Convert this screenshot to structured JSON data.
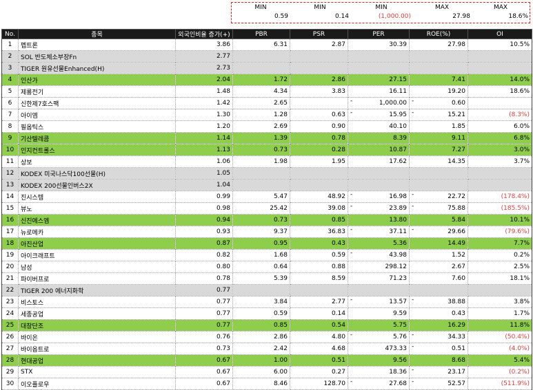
{
  "minmax": [
    {
      "label": "MIN",
      "value": "0.59",
      "negative": false
    },
    {
      "label": "MIN",
      "value": "0.14",
      "negative": false
    },
    {
      "label": "MIN",
      "value": "(1,000.00)",
      "negative": true
    },
    {
      "label": "MAX",
      "value": "27.98",
      "negative": false
    },
    {
      "label": "MAX",
      "value": "18.6%",
      "negative": false
    }
  ],
  "headers": [
    "No.",
    "종목",
    "외국인비율 증가(+)",
    "PBR",
    "PSR",
    "PER",
    "ROE(%)",
    "OI"
  ],
  "rows": [
    {
      "no": "1",
      "name": "펩트론",
      "f": "3.86",
      "pbr": "6.31",
      "psr": "2.87",
      "per": "30.39",
      "roe": "27.98",
      "oi": "10.5%",
      "style": "",
      "oi_neg": false,
      "per_dash": false,
      "roe_dash": false,
      "psr_dash": false
    },
    {
      "no": "2",
      "name": "SOL 반도체소부장Fn",
      "f": "2.77",
      "pbr": "",
      "psr": "",
      "per": "",
      "roe": "",
      "oi": "",
      "style": "grey",
      "oi_neg": false,
      "per_dash": false,
      "roe_dash": false,
      "psr_dash": false
    },
    {
      "no": "3",
      "name": "TIGER 원유선물Enhanced(H)",
      "f": "2.73",
      "pbr": "",
      "psr": "",
      "per": "",
      "roe": "",
      "oi": "",
      "style": "grey",
      "oi_neg": false,
      "per_dash": false,
      "roe_dash": false,
      "psr_dash": false
    },
    {
      "no": "4",
      "name": "인산가",
      "f": "2.04",
      "pbr": "1.72",
      "psr": "2.86",
      "per": "27.15",
      "roe": "7.41",
      "oi": "14.0%",
      "style": "green",
      "oi_neg": false,
      "per_dash": false,
      "roe_dash": false,
      "psr_dash": false
    },
    {
      "no": "5",
      "name": "제룡전기",
      "f": "1.48",
      "pbr": "4.34",
      "psr": "3.83",
      "per": "16.11",
      "roe": "19.20",
      "oi": "18.6%",
      "style": "",
      "oi_neg": false,
      "per_dash": false,
      "roe_dash": false,
      "psr_dash": false
    },
    {
      "no": "6",
      "name": "신한제7호스팩",
      "f": "1.42",
      "pbr": "2.65",
      "psr": "",
      "per": "1,000.00",
      "roe": "0.60",
      "oi": "",
      "style": "",
      "oi_neg": false,
      "per_dash": true,
      "roe_dash": true,
      "psr_dash": false
    },
    {
      "no": "7",
      "name": "아이엠",
      "f": "1.30",
      "pbr": "1.28",
      "psr": "0.63",
      "per": "15.95",
      "roe": "15.21",
      "oi": "(8.3%)",
      "style": "",
      "oi_neg": true,
      "per_dash": true,
      "roe_dash": true,
      "psr_dash": false
    },
    {
      "no": "8",
      "name": "필옵틱스",
      "f": "1.20",
      "pbr": "2.69",
      "psr": "0.90",
      "per": "40.10",
      "roe": "1.85",
      "oi": "6.0%",
      "style": "",
      "oi_neg": false,
      "per_dash": false,
      "roe_dash": false,
      "psr_dash": false
    },
    {
      "no": "9",
      "name": "기산텔레콤",
      "f": "1.14",
      "pbr": "1.39",
      "psr": "0.78",
      "per": "8.39",
      "roe": "9.11",
      "oi": "6.8%",
      "style": "green",
      "oi_neg": false,
      "per_dash": false,
      "roe_dash": false,
      "psr_dash": false
    },
    {
      "no": "10",
      "name": "인지컨트롤스",
      "f": "1.13",
      "pbr": "0.73",
      "psr": "0.28",
      "per": "10.87",
      "roe": "7.27",
      "oi": "3.0%",
      "style": "green",
      "oi_neg": false,
      "per_dash": false,
      "roe_dash": false,
      "psr_dash": false
    },
    {
      "no": "11",
      "name": "상보",
      "f": "1.06",
      "pbr": "1.98",
      "psr": "1.95",
      "per": "17.62",
      "roe": "14.35",
      "oi": "3.7%",
      "style": "",
      "oi_neg": false,
      "per_dash": false,
      "roe_dash": false,
      "psr_dash": false
    },
    {
      "no": "12",
      "name": "KODEX 미국나스닥100선물(H)",
      "f": "1.05",
      "pbr": "",
      "psr": "",
      "per": "",
      "roe": "",
      "oi": "",
      "style": "grey",
      "oi_neg": false,
      "per_dash": false,
      "roe_dash": false,
      "psr_dash": false
    },
    {
      "no": "13",
      "name": "KODEX 200선물인버스2X",
      "f": "1.04",
      "pbr": "",
      "psr": "",
      "per": "",
      "roe": "",
      "oi": "",
      "style": "grey",
      "oi_neg": false,
      "per_dash": false,
      "roe_dash": false,
      "psr_dash": false
    },
    {
      "no": "14",
      "name": "진시스템",
      "f": "0.99",
      "pbr": "5.47",
      "psr": "48.92",
      "per": "16.98",
      "roe": "22.72",
      "oi": "(178.4%)",
      "style": "",
      "oi_neg": true,
      "per_dash": true,
      "roe_dash": true,
      "psr_dash": false
    },
    {
      "no": "15",
      "name": "뷰노",
      "f": "0.98",
      "pbr": "25.42",
      "psr": "39.08",
      "per": "23.89",
      "roe": "75.88",
      "oi": "(185.5%)",
      "style": "",
      "oi_neg": true,
      "per_dash": true,
      "roe_dash": true,
      "psr_dash": false
    },
    {
      "no": "16",
      "name": "신진에스엠",
      "f": "0.94",
      "pbr": "0.73",
      "psr": "0.85",
      "per": "13.80",
      "roe": "5.84",
      "oi": "10.1%",
      "style": "green",
      "oi_neg": false,
      "per_dash": false,
      "roe_dash": false,
      "psr_dash": false
    },
    {
      "no": "17",
      "name": "뉴로메카",
      "f": "0.93",
      "pbr": "9.37",
      "psr": "36.83",
      "per": "37.11",
      "roe": "29.66",
      "oi": "(79.6%)",
      "style": "",
      "oi_neg": true,
      "per_dash": true,
      "roe_dash": true,
      "psr_dash": false
    },
    {
      "no": "18",
      "name": "아진산업",
      "f": "0.87",
      "pbr": "0.95",
      "psr": "0.43",
      "per": "5.36",
      "roe": "14.49",
      "oi": "7.7%",
      "style": "green",
      "oi_neg": false,
      "per_dash": false,
      "roe_dash": false,
      "psr_dash": false
    },
    {
      "no": "19",
      "name": "아이크래프트",
      "f": "0.82",
      "pbr": "1.68",
      "psr": "0.59",
      "per": "43.98",
      "roe": "1.52",
      "oi": "0.2%",
      "style": "",
      "oi_neg": false,
      "per_dash": true,
      "roe_dash": false,
      "psr_dash": false
    },
    {
      "no": "20",
      "name": "남성",
      "f": "0.80",
      "pbr": "0.64",
      "psr": "0.88",
      "per": "298.12",
      "roe": "2.67",
      "oi": "2.5%",
      "style": "",
      "oi_neg": false,
      "per_dash": false,
      "roe_dash": false,
      "psr_dash": false
    },
    {
      "no": "21",
      "name": "파이버프로",
      "f": "0.78",
      "pbr": "5.39",
      "psr": "8.59",
      "per": "71.23",
      "roe": "7.60",
      "oi": "18.1%",
      "style": "",
      "oi_neg": false,
      "per_dash": false,
      "roe_dash": false,
      "psr_dash": false
    },
    {
      "no": "22",
      "name": "TIGER 200 에너지화학",
      "f": "0.77",
      "pbr": "",
      "psr": "",
      "per": "",
      "roe": "",
      "oi": "",
      "style": "grey",
      "oi_neg": false,
      "per_dash": false,
      "roe_dash": false,
      "psr_dash": false
    },
    {
      "no": "23",
      "name": "비스토스",
      "f": "0.77",
      "pbr": "3.84",
      "psr": "2.77",
      "per": "13.57",
      "roe": "38.88",
      "oi": "3.8%",
      "style": "",
      "oi_neg": false,
      "per_dash": true,
      "roe_dash": true,
      "psr_dash": false
    },
    {
      "no": "24",
      "name": "세종공업",
      "f": "0.77",
      "pbr": "0.59",
      "psr": "0.14",
      "per": "9.59",
      "roe": "0.43",
      "oi": "1.7%",
      "style": "",
      "oi_neg": false,
      "per_dash": false,
      "roe_dash": false,
      "psr_dash": false
    },
    {
      "no": "25",
      "name": "대창단조",
      "f": "0.77",
      "pbr": "0.85",
      "psr": "0.54",
      "per": "5.75",
      "roe": "16.29",
      "oi": "11.8%",
      "style": "green",
      "oi_neg": false,
      "per_dash": false,
      "roe_dash": false,
      "psr_dash": false
    },
    {
      "no": "26",
      "name": "바이온",
      "f": "0.76",
      "pbr": "2.86",
      "psr": "4.80",
      "per": "5.76",
      "roe": "34.33",
      "oi": "(50.4%)",
      "style": "",
      "oi_neg": true,
      "per_dash": true,
      "roe_dash": true,
      "psr_dash": false
    },
    {
      "no": "27",
      "name": "바이옵트로",
      "f": "0.73",
      "pbr": "2.42",
      "psr": "4.68",
      "per": "473.33",
      "roe": "0.51",
      "oi": "(4.0%)",
      "style": "",
      "oi_neg": true,
      "per_dash": false,
      "roe_dash": true,
      "psr_dash": false
    },
    {
      "no": "28",
      "name": "현대공업",
      "f": "0.67",
      "pbr": "1.00",
      "psr": "0.51",
      "per": "9.56",
      "roe": "8.68",
      "oi": "5.4%",
      "style": "green",
      "oi_neg": false,
      "per_dash": false,
      "roe_dash": false,
      "psr_dash": false
    },
    {
      "no": "29",
      "name": "STX",
      "f": "0.67",
      "pbr": "6.00",
      "psr": "0.27",
      "per": "18.36",
      "roe": "23.17",
      "oi": "(0.2%)",
      "style": "",
      "oi_neg": true,
      "per_dash": false,
      "roe_dash": true,
      "psr_dash": false
    },
    {
      "no": "30",
      "name": "이오플로우",
      "f": "0.67",
      "pbr": "8.46",
      "psr": "128.70",
      "per": "27.68",
      "roe": "52.57",
      "oi": "(511.9%)",
      "style": "",
      "oi_neg": true,
      "per_dash": true,
      "roe_dash": true,
      "psr_dash": false
    }
  ],
  "colors": {
    "header_bg": "#1a1a1a",
    "highlight_green": "#8fce4c",
    "etf_grey": "#d9d9d9",
    "negative_red": "#e23b3b",
    "dashed_box": "#e02020"
  }
}
